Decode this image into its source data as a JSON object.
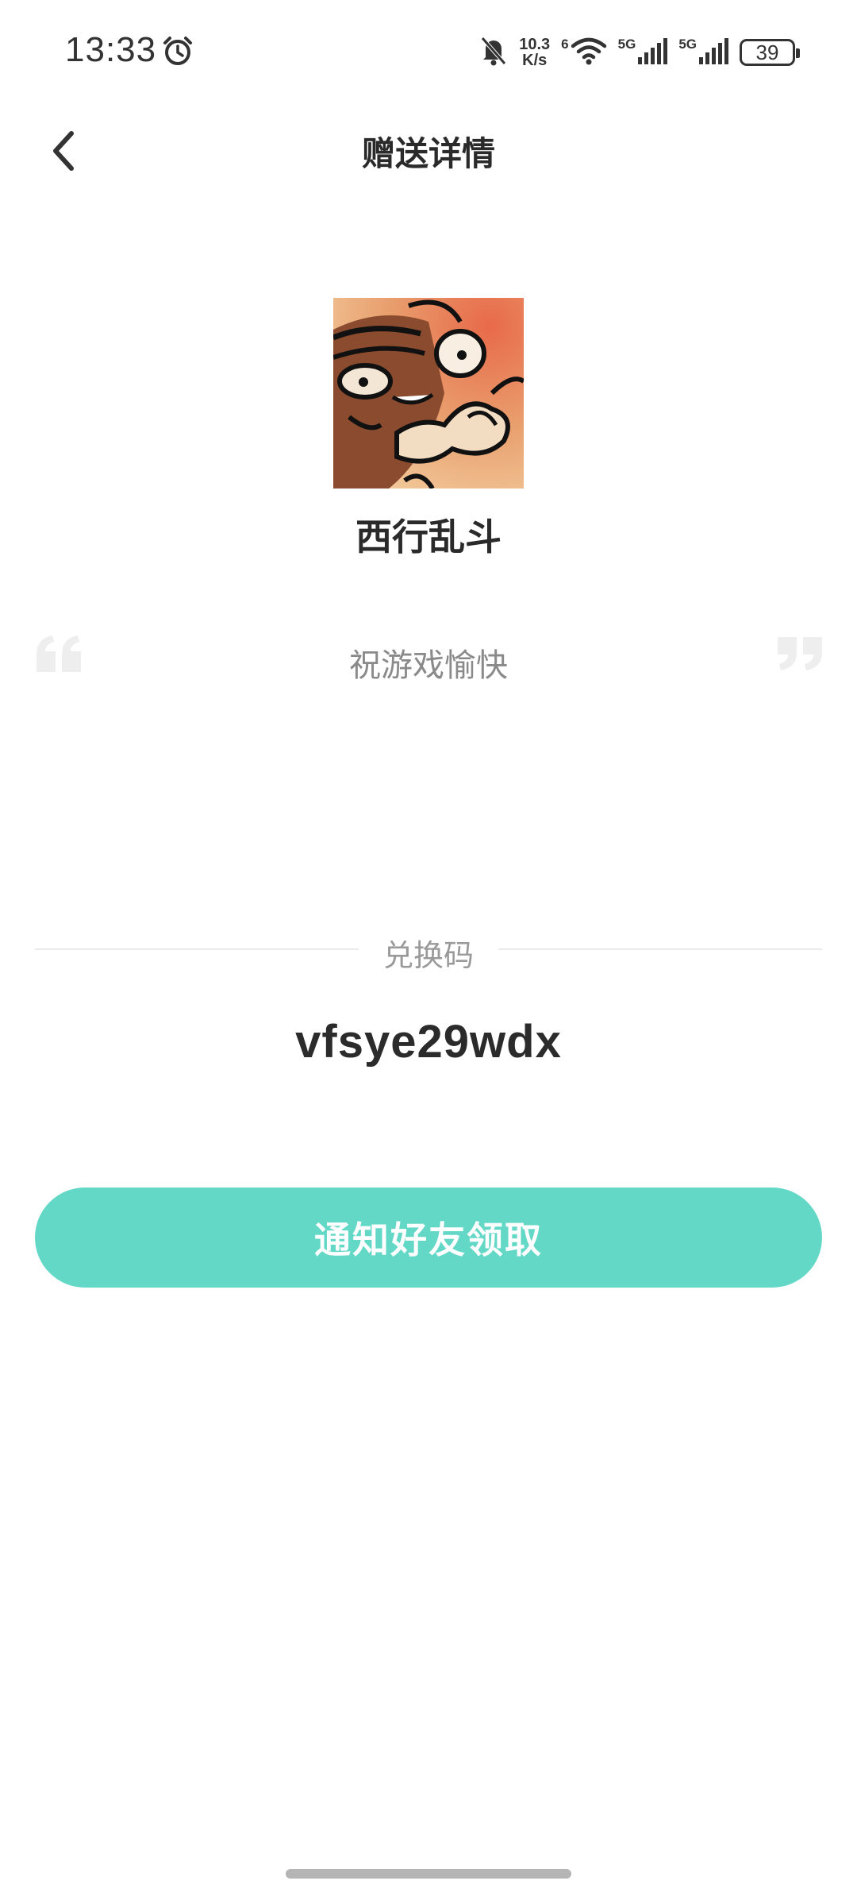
{
  "status_bar": {
    "time": "13:33",
    "net_speed_value": "10.3",
    "net_speed_unit": "K/s",
    "wifi_badge": "6",
    "sim1_label": "5G",
    "sim2_label": "5G",
    "battery_level": "39"
  },
  "header": {
    "title": "赠送详情"
  },
  "gift": {
    "game_name": "西行乱斗",
    "message": "祝游戏愉快"
  },
  "redeem": {
    "label": "兑换码",
    "code": "vfsye29wdx"
  },
  "actions": {
    "notify_label": "通知好友领取"
  },
  "colors": {
    "accent": "#63d8c6",
    "title_text": "#2a2a2a",
    "muted_text": "#8a8a8a",
    "quote_mark": "#eeeeee"
  },
  "icons": [
    "alarm-icon",
    "bell-off-icon",
    "wifi-icon",
    "signal-icon",
    "battery-icon",
    "back-arrow-icon",
    "quote-open-icon",
    "quote-close-icon"
  ]
}
